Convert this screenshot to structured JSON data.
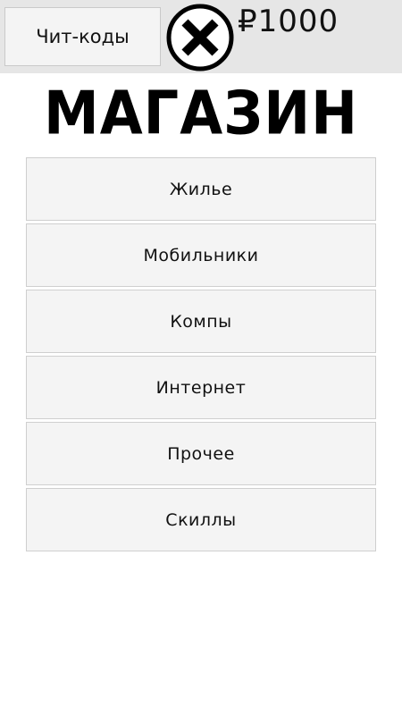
{
  "topbar": {
    "cheat_codes_label": "Чит-коды",
    "close_icon": "close-circle-icon",
    "money": "₽1000"
  },
  "title": "МАГАЗИН",
  "menu": {
    "items": [
      {
        "label": "Жилье"
      },
      {
        "label": "Мобильники"
      },
      {
        "label": "Компы"
      },
      {
        "label": "Интернет"
      },
      {
        "label": "Прочее"
      },
      {
        "label": "Скиллы"
      }
    ]
  },
  "colors": {
    "topbar_bg": "#e6e6e6",
    "button_bg": "#f4f4f4",
    "text": "#111111"
  }
}
